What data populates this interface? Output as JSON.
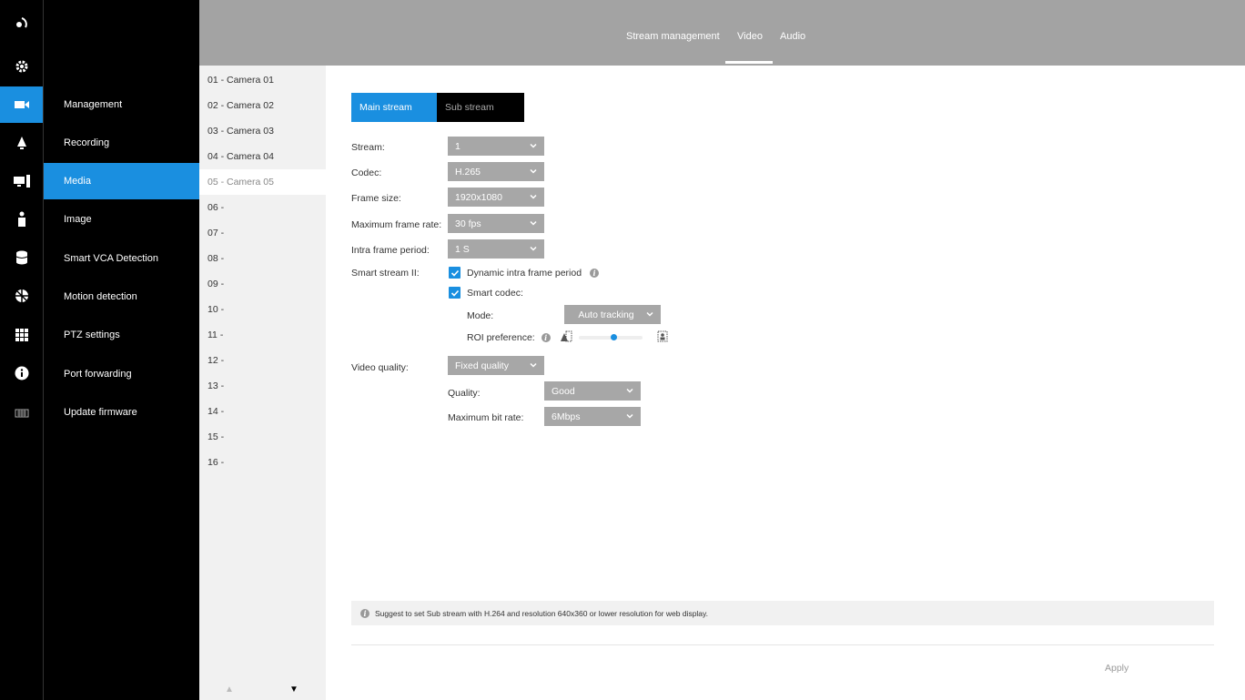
{
  "top_tabs": [
    {
      "label": "Stream management"
    },
    {
      "label": "Video"
    },
    {
      "label": "Audio"
    }
  ],
  "rail_icons": [
    "logo-icon",
    "gear-icon",
    "camera-icon",
    "bell-icon",
    "monitor-icon",
    "user-icon",
    "database-icon",
    "network-icon",
    "grid-icon",
    "info-icon",
    "keyboard-icon"
  ],
  "menu": {
    "items": [
      {
        "label": "Management"
      },
      {
        "label": "Recording"
      },
      {
        "label": "Media"
      },
      {
        "label": "Image"
      },
      {
        "label": "Smart VCA Detection"
      },
      {
        "label": "Motion detection"
      },
      {
        "label": "PTZ settings"
      },
      {
        "label": "Port forwarding"
      },
      {
        "label": "Update firmware"
      }
    ],
    "active": "Media"
  },
  "cameras": [
    "01 - Camera 01",
    "02 - Camera 02",
    "03 - Camera 03",
    "04 - Camera 04",
    "05 - Camera 05",
    "06 -",
    "07 -",
    "08 -",
    "09 -",
    "10 -",
    "11 -",
    "12 -",
    "13 -",
    "14 -",
    "15 -",
    "16 -"
  ],
  "selected_camera": "05 - Camera 05",
  "stream_tabs": {
    "main": "Main stream",
    "sub": "Sub stream",
    "active": "Main stream"
  },
  "form": {
    "stream": {
      "label": "Stream:",
      "value": "1"
    },
    "codec": {
      "label": "Codec:",
      "value": "H.265"
    },
    "frame_size": {
      "label": "Frame size:",
      "value": "1920x1080"
    },
    "max_frame_rate": {
      "label": "Maximum frame rate:",
      "value": "30 fps"
    },
    "intra_frame_period": {
      "label": "Intra frame period:",
      "value": "1 S"
    },
    "smart_stream": {
      "label": "Smart stream II:",
      "dynamic_intra": {
        "label": "Dynamic intra frame period",
        "checked": true
      },
      "smart_codec": {
        "label": "Smart codec:",
        "checked": true
      },
      "mode": {
        "label": "Mode:",
        "value": "Auto tracking"
      },
      "roi": {
        "label": "ROI preference:",
        "level": 0.55
      }
    },
    "video_quality": {
      "label": "Video quality:",
      "value": "Fixed quality"
    },
    "quality": {
      "label": "Quality:",
      "value": "Good"
    },
    "max_bit_rate": {
      "label": "Maximum bit rate:",
      "value": "6Mbps"
    }
  },
  "notice": "Suggest to set Sub stream with H.264 and resolution 640x360 or lower resolution for web display.",
  "apply_label": "Apply",
  "colors": {
    "accent": "#1a8fe0",
    "topbar": "#a3a3a3",
    "select": "#a7a7a7"
  }
}
